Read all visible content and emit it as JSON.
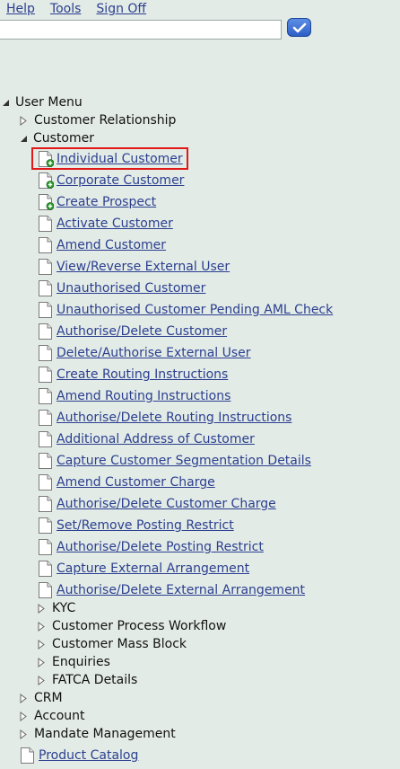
{
  "top_links": {
    "help": "Help",
    "tools": "Tools",
    "sign_off": "Sign Off"
  },
  "search": {
    "value": "",
    "placeholder": ""
  },
  "tree": {
    "root": "User Menu",
    "customer_relationship": "Customer Relationship",
    "customer": "Customer",
    "customer_items": [
      "Individual Customer",
      "Corporate Customer",
      "Create Prospect",
      "Activate Customer",
      "Amend Customer",
      "View/Reverse External User",
      "Unauthorised Customer",
      "Unauthorised Customer Pending AML Check",
      "Authorise/Delete Customer",
      "Delete/Authorise External User",
      "Create Routing Instructions",
      "Amend Routing Instructions",
      "Authorise/Delete Routing Instructions",
      "Additional Address of Customer",
      "Capture Customer Segmentation Details",
      "Amend Customer Charge",
      "Authorise/Delete Customer Charge",
      "Set/Remove Posting Restrict",
      "Authorise/Delete Posting Restrict",
      "Capture External Arrangement",
      "Authorise/Delete External Arrangement"
    ],
    "customer_subfolders": [
      "KYC",
      "Customer Process Workflow",
      "Customer Mass Block",
      "Enquiries",
      "FATCA Details"
    ],
    "top_folders": [
      "CRM",
      "Account",
      "Mandate Management"
    ],
    "product_catalog": "Product Catalog"
  },
  "colors": {
    "background": "#e3ebe7",
    "link": "#2b3f8f",
    "highlight": "#e01818"
  }
}
